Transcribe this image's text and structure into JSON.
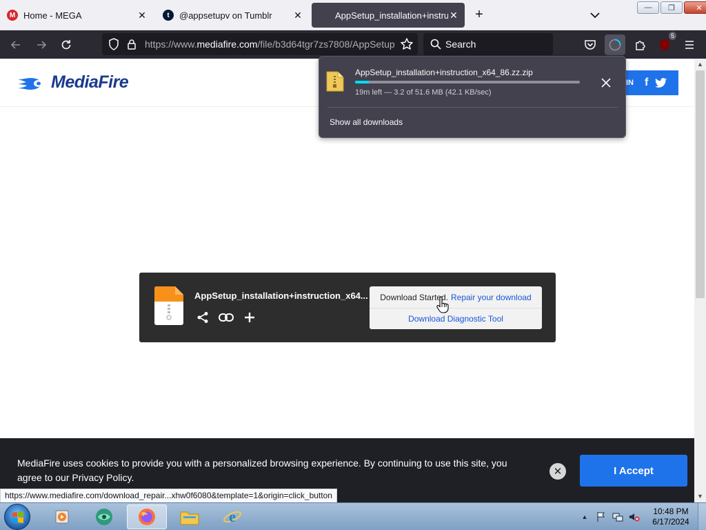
{
  "tabs": [
    {
      "label": "Home - MEGA",
      "icon": "mega-icon",
      "color": "#d9272e"
    },
    {
      "label": "@appsetupv on Tumblr",
      "icon": "tumblr-icon",
      "color": "#001935"
    },
    {
      "label": "AppSetup_installation+instructio",
      "icon": "mediafire-icon",
      "active": true
    }
  ],
  "window_controls": {
    "minimize": "—",
    "restore": "❐",
    "close": "✕"
  },
  "navbar": {
    "url_prefix": "https://www.",
    "url_host": "mediafire.com",
    "url_path": "/file/b3d64tgr7zs7808/AppSetup",
    "search_placeholder": "Search",
    "extension_badge": "5"
  },
  "mediafire": {
    "logo_text": "MediaFire",
    "social_in": "IN",
    "file_name": "AppSetup_installation+instruction_x64...",
    "download_started": "Download Started.",
    "repair_link": "Repair your download",
    "diagnostic_link": "Download Diagnostic Tool"
  },
  "downloads_panel": {
    "file_name": "AppSetup_installation+instruction_x64_86.zz.zip",
    "status": "19m left — 3.2 of 51.6 MB (42.1 KB/sec)",
    "progress": 0.062,
    "show_all": "Show all downloads"
  },
  "cookie": {
    "text": "MediaFire uses cookies to provide you with a personalized browsing experience. By continuing to use this site, you agree to our Privacy Policy.",
    "accept": "I Accept"
  },
  "status_url": "https://www.mediafire.com/download_repair...xhw0f6080&template=1&origin=click_button",
  "taskbar": {
    "time": "10:48 PM",
    "date": "6/17/2024"
  },
  "colors": {
    "accent": "#1f73ea",
    "toolbar": "#2b2a33",
    "progress": "#00ddff"
  }
}
